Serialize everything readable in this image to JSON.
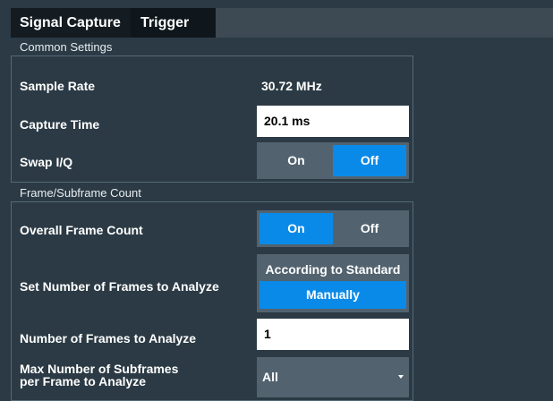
{
  "tabs": [
    {
      "label": "Signal Capture"
    },
    {
      "label": "Trigger"
    }
  ],
  "common": {
    "title": "Common Settings",
    "sample_rate": {
      "label": "Sample Rate",
      "value": "30.72 MHz"
    },
    "capture_time": {
      "label": "Capture Time",
      "value": "20.1 ms"
    },
    "swap_iq": {
      "label": "Swap I/Q",
      "on": "On",
      "off": "Off",
      "selected": "Off"
    }
  },
  "frames": {
    "title": "Frame/Subframe Count",
    "overall_frame_count": {
      "label": "Overall Frame Count",
      "on": "On",
      "off": "Off",
      "selected": "On"
    },
    "set_number": {
      "label": "Set Number of Frames to Analyze",
      "opt1": "According to Standard",
      "opt2": "Manually",
      "selected": "Manually"
    },
    "number_of_frames": {
      "label": "Number of Frames to Analyze",
      "value": "1"
    },
    "max_subframes": {
      "label_line1": "Max Number of Subframes",
      "label_line2": "per Frame to Analyze",
      "value": "All"
    }
  },
  "colors": {
    "accent": "#0a8ae8",
    "background": "#2b3a44",
    "control": "#52636f"
  },
  "icons": {
    "dropdown": "chevron-down-icon"
  }
}
